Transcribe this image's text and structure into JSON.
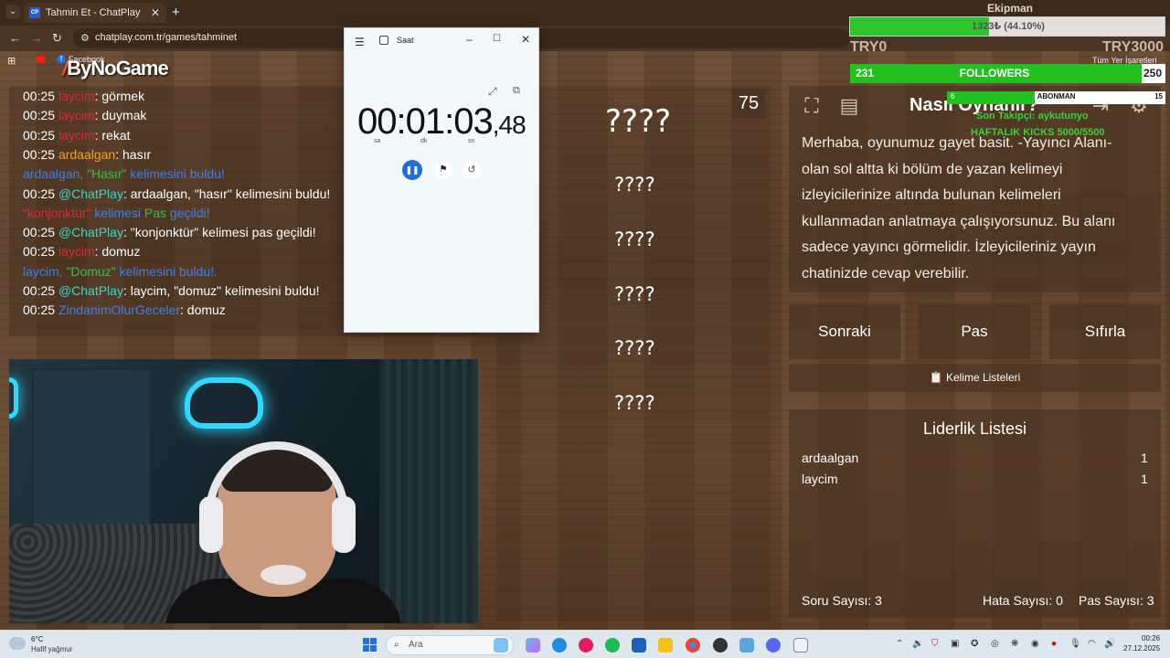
{
  "browser": {
    "tab_title": "Tahmin Et - ChatPlay",
    "tab_favicon": "CP",
    "url": "chatplay.com.tr/games/tahminet",
    "bookmark_label": "Facebook",
    "all_bookmarks": "Tüm Yer İşaretleri"
  },
  "logo": {
    "text": "ByNoGame"
  },
  "chat": [
    {
      "time": "00:25",
      "user": "laycim",
      "user_color": "#e0283a",
      "msg": ": görmek"
    },
    {
      "time": "00:25",
      "user": "laycim",
      "user_color": "#e0283a",
      "msg": ": duymak"
    },
    {
      "time": "00:25",
      "user": "laycim",
      "user_color": "#e0283a",
      "msg": ": rekat"
    },
    {
      "time": "00:25",
      "user": "ardaalgan",
      "user_color": "#f6a11a",
      "msg": ": hasır"
    },
    {
      "time": "",
      "user": "ardaalgan, ",
      "user_color": "#3f7fe8",
      "quoted": "\"Hasır\"",
      "msg": " kelimesini buldu!"
    },
    {
      "time": "00:25",
      "user": "@ChatPlay",
      "user_color": "#3ad6c8",
      "msg": ": ardaalgan, \"hasır\" kelimesini buldu!"
    },
    {
      "time": "",
      "user": "\"konjonktür\"",
      "user_color": "#e0283a",
      "quoted": "",
      "msg": " kelimesi ",
      "extra_green": "Pas",
      "extra_tail": " geçildi!"
    },
    {
      "time": "00:25",
      "user": "@ChatPlay",
      "user_color": "#3ad6c8",
      "msg": ": \"konjonktür\" kelimesi pas geçildi!"
    },
    {
      "time": "00:25",
      "user": "laycim",
      "user_color": "#e0283a",
      "msg": ": domuz"
    },
    {
      "time": "",
      "user": "laycim, ",
      "user_color": "#3f7fe8",
      "quoted": "\"Domuz\"",
      "msg": " kelimesini buldu!."
    },
    {
      "time": "00:25",
      "user": "@ChatPlay",
      "user_color": "#3ad6c8",
      "msg": ": laycim, \"domuz\" kelimesini buldu!"
    },
    {
      "time": "00:25",
      "user": "ZindanimOlurGeceler",
      "user_color": "#3f7fe8",
      "msg": ": domuz"
    }
  ],
  "words": {
    "countdown": "75",
    "items": [
      "????",
      "????",
      "????",
      "????",
      "????",
      "????"
    ]
  },
  "clock_app": {
    "title": "Saat",
    "hours": "00",
    "minutes": "01",
    "seconds": "03",
    "hundredths": "48",
    "unit_h": "sa",
    "unit_m": "dk",
    "unit_s": "sn"
  },
  "howto": {
    "title": "Nasıl Oynanır?",
    "text": "Merhaba, oyunumuz gayet basit. -Yayıncı Alanı- olan sol altta ki bölüm de yazan kelimeyi izleyicilerinize altında bulunan kelimeleri kullanmadan anlatmaya çalışıyorsunuz. Bu alanı sadece yayıncı görmelidir. İzleyicileriniz yayın chatinizde cevap verebilir."
  },
  "buttons": {
    "next": "Sonraki",
    "pass": "Pas",
    "reset": "Sıfırla",
    "word_lists": "📋 Kelime Listeleri"
  },
  "leaderboard": {
    "title": "Liderlik Listesi",
    "rows": [
      {
        "name": "ardaalgan",
        "score": "1"
      },
      {
        "name": "laycim",
        "score": "1"
      }
    ]
  },
  "stats": {
    "questions": "Soru Sayısı: 3",
    "errors": "Hata Sayısı: 0",
    "passes": "Pas Sayısı: 3"
  },
  "overlay": {
    "goal_title": "Ekipman",
    "goal_text": "1323₺ (44.10%)",
    "goal_fill": 0.441,
    "try_left": "TRY0",
    "try_right": "TRY3000",
    "followers_label": "FOLLOWERS",
    "followers_current": "231",
    "followers_target": "250",
    "followers_fill": 0.924,
    "sub_label": "ABONMAN",
    "sub_current": "6",
    "sub_target": "15",
    "sub_fill": 0.4,
    "last_follower": "Son Takipçi: aykutunyo",
    "weekly_kicks": "HAFTALIK KICKS 5000/5500"
  },
  "taskbar": {
    "temp": "6°C",
    "weather": "Hafif yağmur",
    "search_placeholder": "Ara",
    "time": "00:26",
    "date": "27.12.2025"
  },
  "colors": {
    "accent_green": "#22c11f",
    "wood": "#5a3e28",
    "pause_blue": "#1f6fd8"
  }
}
